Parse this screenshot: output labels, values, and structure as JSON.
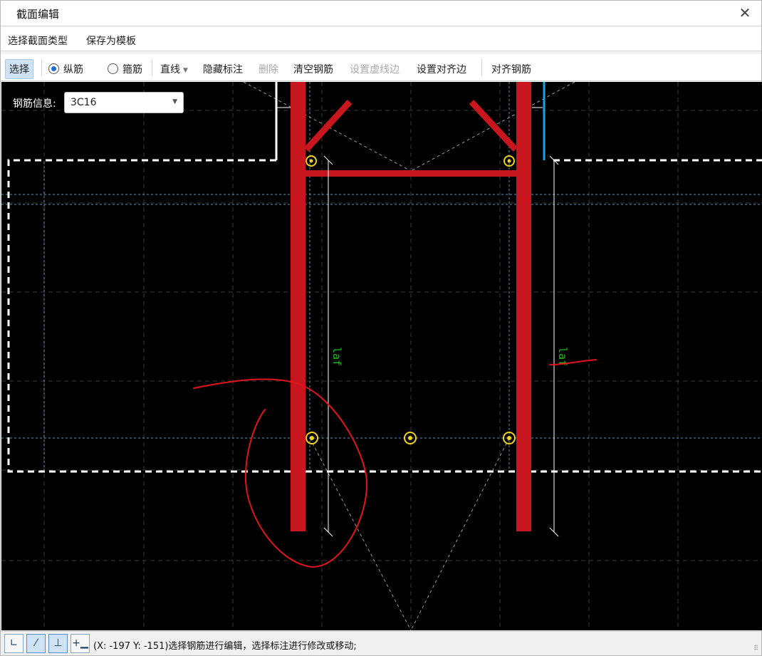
{
  "window": {
    "title": "截面编辑"
  },
  "menu": {
    "items": [
      "选择截面类型",
      "保存为模板"
    ]
  },
  "toolbar": {
    "select": "选择",
    "longitudinal": "纵筋",
    "stirrup": "箍筋",
    "line": "直线",
    "hide_annotation": "隐藏标注",
    "delete": "删除",
    "clear_rebar": "清空钢筋",
    "set_dashed_edge": "设置虚线边",
    "set_align_edge": "设置对齐边",
    "align_rebar": "对齐钢筋"
  },
  "rebar_info": {
    "label": "钢筋信息:",
    "value": "3C16"
  },
  "canvas": {
    "dimension_label_left": "laf",
    "dimension_label_right": "laf",
    "colors": {
      "background": "#000000",
      "rebar": "#c8161e",
      "dot": "#f2d21b",
      "dimension_text": "#19c219",
      "grid": "#3a3a3a",
      "edge": "#ffffff",
      "blue_edge": "#1ea0e6"
    }
  },
  "status": {
    "text": "(X: -197 Y: -151)选择钢筋进行编辑，选择标注进行修改或移动;"
  },
  "status_icons": [
    "orthogonal-icon",
    "line-snap-icon",
    "perpendicular-icon",
    "add-point-icon"
  ]
}
